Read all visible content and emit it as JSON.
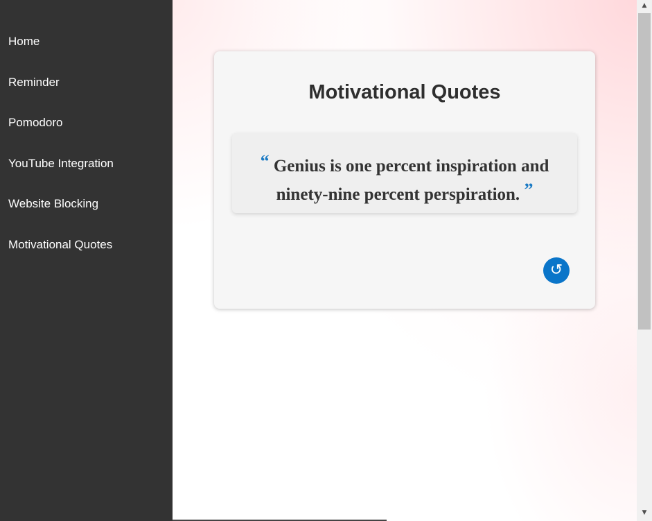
{
  "sidebar": {
    "items": [
      {
        "label": "Home"
      },
      {
        "label": "Reminder"
      },
      {
        "label": "Pomodoro"
      },
      {
        "label": "YouTube Integration"
      },
      {
        "label": "Website Blocking"
      },
      {
        "label": "Motivational Quotes"
      }
    ]
  },
  "card": {
    "title": "Motivational Quotes",
    "quote": {
      "open_mark": "“",
      "text": "Genius is one percent inspiration and ninety-nine percent perspiration.",
      "close_mark": "”"
    },
    "refresh_icon": "refresh-icon",
    "refresh_glyph": "↺"
  },
  "scrollbar": {
    "up_glyph": "▲",
    "down_glyph": "▼"
  },
  "colors": {
    "sidebar_bg": "#333333",
    "accent": "#0a75c9",
    "quote_mark": "#1a7ac4",
    "card_bg": "#f6f6f6",
    "text": "#2e2e2e"
  }
}
